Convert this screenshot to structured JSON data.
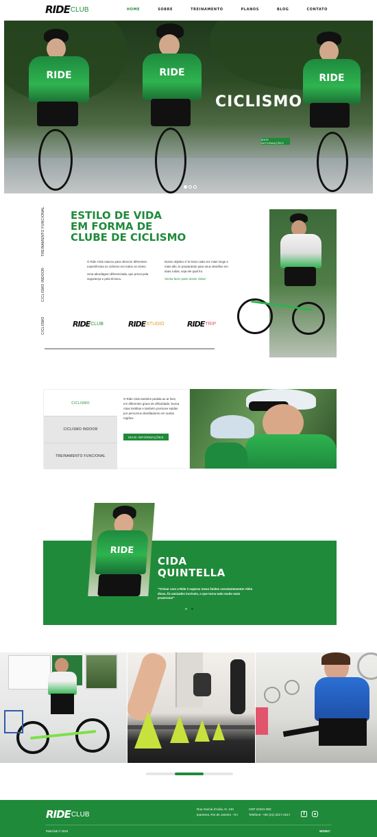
{
  "nav": {
    "logo_main": "RIDE",
    "logo_sub": "CLUB",
    "items": [
      "HOME",
      "SOBRE",
      "TREINAMENTO",
      "PLANOS",
      "BLOG",
      "CONTATO"
    ]
  },
  "hero": {
    "title": "CICLISMO",
    "button": "MAIS INFORMAÇÕES",
    "jersey_text": "RIDE",
    "slides": 3,
    "active_slide": 1
  },
  "estilo": {
    "side_labels": [
      "TREINAMENTO FUNCIONAL",
      "CICLISMO INDOOR",
      "CICLISMO"
    ],
    "title_lines": [
      "ESTILO DE VIDA",
      "EM FORMA DE",
      "CLUBE DE CICLISMO"
    ],
    "col1_p1": "O Ride Club nasceu para oferecer diferentes experiências no ciclismo em todos os níveis.",
    "col1_p2": "Uma abordagem diferenciada, que preza pela segurança e pela técnica.",
    "col2_p1": "Nosso objetivo é te levar cada vez mais longe e mais alto, te preparando para seus desafios em duas rodas, seja ele qual for.",
    "col2_link": "Venha fazer parte desse clube!",
    "brands": [
      {
        "main": "RIDE",
        "sub": "CLUB",
        "color": "#1f8a3a"
      },
      {
        "main": "RIDE",
        "sub": "STUDIO",
        "color": "#e39a2d"
      },
      {
        "main": "RIDE",
        "sub": "TRIP",
        "color": "#e2536c"
      }
    ]
  },
  "modalidades": {
    "tabs": [
      "CICLISMO",
      "CICLISMO INDOOR",
      "TREINAMENTO FUNCIONAL"
    ],
    "selected": "CICLISMO",
    "text": "O Ride Club também pedala ao ar livre, em diferentes graus de dificuldade, busca rotas inéditas e também promove saídas por percursos desafiadores em outras regiões.",
    "button": "MAIS INFORMAÇÕES"
  },
  "depoimento": {
    "name_lines": [
      "CIDA",
      "QUINTELLA"
    ],
    "quote": "\"Treinar com a Ride é superar meus limites constantemente! Além disso, fiz amizades incríveis, o que torna tudo muito mais prazeroso!\"",
    "jersey_text": "RIDE"
  },
  "footer": {
    "logo_main": "RIDE",
    "logo_sub": "CLUB",
    "address_line1": "Rua Garcia d'Avila, N. 130",
    "address_line2": "Ipanema, Rio de Janeiro - RJ",
    "cep": "CEP 22431-002",
    "phone": "Telefone: +55 (21) 3217-4217",
    "copyright": "RideClub © 2018",
    "credit": "WDWC"
  },
  "colors": {
    "brand_green": "#1f8a3a",
    "dark": "#111111"
  }
}
